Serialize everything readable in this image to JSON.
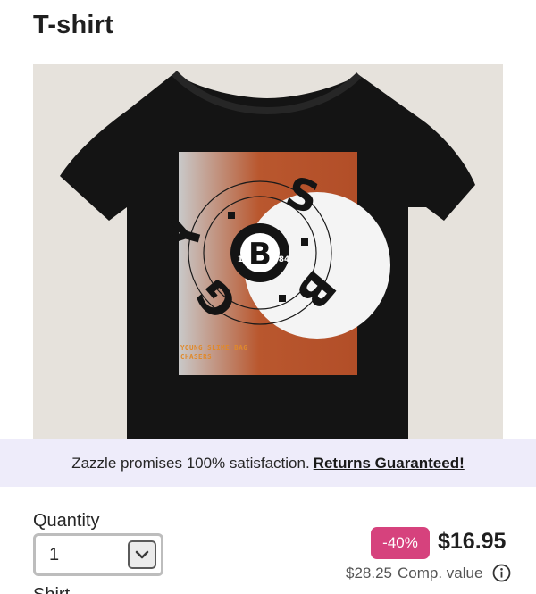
{
  "page": {
    "title": "T-shirt"
  },
  "product_image": {
    "alt": "T-shirt",
    "print": {
      "center_letter": "B",
      "left_digits": "19",
      "right_digits": "84",
      "ring_letters": [
        "Y",
        "S",
        "G",
        "B"
      ],
      "caption_line1": "YOUNG SLIME BAG",
      "caption_line2": "CHASERS"
    },
    "colors": {
      "shirt": "#141414",
      "background": "#e6e2dc",
      "rust": "#b9572e",
      "caption": "#e0892b"
    }
  },
  "banner": {
    "text": "Zazzle promises 100% satisfaction.",
    "link": "Returns Guaranteed!"
  },
  "quantity": {
    "label": "Quantity",
    "value": "1",
    "icon": "chevron-down-icon"
  },
  "pricing": {
    "discount": "-40%",
    "price": "$16.95",
    "original_price": "$28.25",
    "comp_label": "Comp. value",
    "info_icon": "info-icon",
    "colors": {
      "badge": "#d6427d"
    }
  },
  "next_section": {
    "label": "Shirt"
  }
}
